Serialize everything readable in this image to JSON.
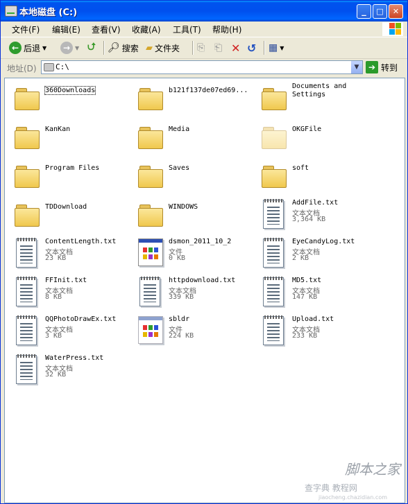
{
  "window": {
    "title": "本地磁盘 (C:)",
    "min": "_",
    "max": "□",
    "close": "✕"
  },
  "menu": [
    "文件(F)",
    "编辑(E)",
    "查看(V)",
    "收藏(A)",
    "工具(T)",
    "帮助(H)"
  ],
  "toolbar": {
    "back": "后退",
    "search": "搜索",
    "folders": "文件夹"
  },
  "address": {
    "label": "地址(D)",
    "value": "C:\\",
    "go": "转到"
  },
  "items": [
    {
      "name": "360Downloads",
      "kind": "folder",
      "selected": true
    },
    {
      "name": "b121f137de07ed69...",
      "kind": "folder"
    },
    {
      "name": "Documents and Settings",
      "kind": "folder"
    },
    {
      "name": "KanKan",
      "kind": "folder"
    },
    {
      "name": "Media",
      "kind": "folder"
    },
    {
      "name": "OKGFile",
      "kind": "folder-hidden"
    },
    {
      "name": "Program Files",
      "kind": "folder"
    },
    {
      "name": "Saves",
      "kind": "folder"
    },
    {
      "name": "soft",
      "kind": "folder"
    },
    {
      "name": "TDDownload",
      "kind": "folder"
    },
    {
      "name": "WINDOWS",
      "kind": "folder"
    },
    {
      "name": "AddFile.txt",
      "kind": "doc",
      "type": "文本文档",
      "size": "3,364 KB"
    },
    {
      "name": "ContentLength.txt",
      "kind": "doc",
      "type": "文本文档",
      "size": "23 KB"
    },
    {
      "name": "dsmon_2011_10_2",
      "kind": "app",
      "type": "文件",
      "size": "0 KB"
    },
    {
      "name": "EyeCandyLog.txt",
      "kind": "doc",
      "type": "文本文档",
      "size": "2 KB"
    },
    {
      "name": "FFInit.txt",
      "kind": "doc",
      "type": "文本文档",
      "size": "8 KB"
    },
    {
      "name": "httpdownload.txt",
      "kind": "doc",
      "type": "文本文档",
      "size": "339 KB"
    },
    {
      "name": "MD5.txt",
      "kind": "doc",
      "type": "文本文档",
      "size": "147 KB"
    },
    {
      "name": "QQPhotoDrawEx.txt",
      "kind": "doc",
      "type": "文本文档",
      "size": "3 KB"
    },
    {
      "name": "sbldr",
      "kind": "app-light",
      "type": "文件",
      "size": "224 KB"
    },
    {
      "name": "Upload.txt",
      "kind": "doc",
      "type": "文本文档",
      "size": "233 KB"
    },
    {
      "name": "WaterPress.txt",
      "kind": "doc",
      "type": "文本文档",
      "size": "32 KB"
    }
  ],
  "watermark": {
    "line1": "脚本之家",
    "line2": "查字典 教程网",
    "line3": "jiaocheng.chazidian.com"
  }
}
